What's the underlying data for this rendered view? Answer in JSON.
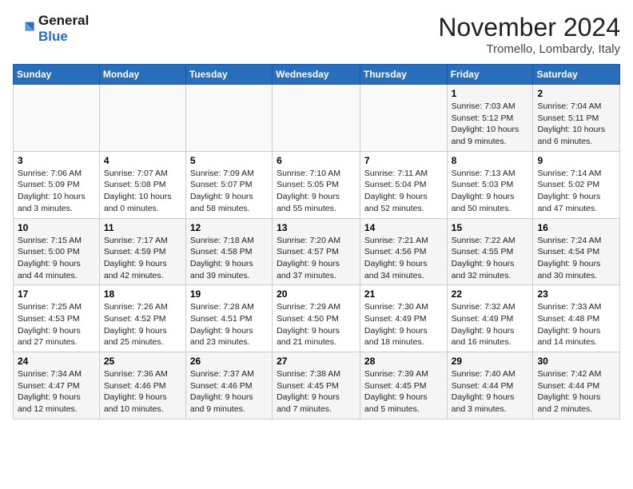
{
  "logo": {
    "text_general": "General",
    "text_blue": "Blue"
  },
  "title": "November 2024",
  "location": "Tromello, Lombardy, Italy",
  "weekdays": [
    "Sunday",
    "Monday",
    "Tuesday",
    "Wednesday",
    "Thursday",
    "Friday",
    "Saturday"
  ],
  "weeks": [
    [
      {
        "day": "",
        "info": ""
      },
      {
        "day": "",
        "info": ""
      },
      {
        "day": "",
        "info": ""
      },
      {
        "day": "",
        "info": ""
      },
      {
        "day": "",
        "info": ""
      },
      {
        "day": "1",
        "info": "Sunrise: 7:03 AM\nSunset: 5:12 PM\nDaylight: 10 hours and 9 minutes."
      },
      {
        "day": "2",
        "info": "Sunrise: 7:04 AM\nSunset: 5:11 PM\nDaylight: 10 hours and 6 minutes."
      }
    ],
    [
      {
        "day": "3",
        "info": "Sunrise: 7:06 AM\nSunset: 5:09 PM\nDaylight: 10 hours and 3 minutes."
      },
      {
        "day": "4",
        "info": "Sunrise: 7:07 AM\nSunset: 5:08 PM\nDaylight: 10 hours and 0 minutes."
      },
      {
        "day": "5",
        "info": "Sunrise: 7:09 AM\nSunset: 5:07 PM\nDaylight: 9 hours and 58 minutes."
      },
      {
        "day": "6",
        "info": "Sunrise: 7:10 AM\nSunset: 5:05 PM\nDaylight: 9 hours and 55 minutes."
      },
      {
        "day": "7",
        "info": "Sunrise: 7:11 AM\nSunset: 5:04 PM\nDaylight: 9 hours and 52 minutes."
      },
      {
        "day": "8",
        "info": "Sunrise: 7:13 AM\nSunset: 5:03 PM\nDaylight: 9 hours and 50 minutes."
      },
      {
        "day": "9",
        "info": "Sunrise: 7:14 AM\nSunset: 5:02 PM\nDaylight: 9 hours and 47 minutes."
      }
    ],
    [
      {
        "day": "10",
        "info": "Sunrise: 7:15 AM\nSunset: 5:00 PM\nDaylight: 9 hours and 44 minutes."
      },
      {
        "day": "11",
        "info": "Sunrise: 7:17 AM\nSunset: 4:59 PM\nDaylight: 9 hours and 42 minutes."
      },
      {
        "day": "12",
        "info": "Sunrise: 7:18 AM\nSunset: 4:58 PM\nDaylight: 9 hours and 39 minutes."
      },
      {
        "day": "13",
        "info": "Sunrise: 7:20 AM\nSunset: 4:57 PM\nDaylight: 9 hours and 37 minutes."
      },
      {
        "day": "14",
        "info": "Sunrise: 7:21 AM\nSunset: 4:56 PM\nDaylight: 9 hours and 34 minutes."
      },
      {
        "day": "15",
        "info": "Sunrise: 7:22 AM\nSunset: 4:55 PM\nDaylight: 9 hours and 32 minutes."
      },
      {
        "day": "16",
        "info": "Sunrise: 7:24 AM\nSunset: 4:54 PM\nDaylight: 9 hours and 30 minutes."
      }
    ],
    [
      {
        "day": "17",
        "info": "Sunrise: 7:25 AM\nSunset: 4:53 PM\nDaylight: 9 hours and 27 minutes."
      },
      {
        "day": "18",
        "info": "Sunrise: 7:26 AM\nSunset: 4:52 PM\nDaylight: 9 hours and 25 minutes."
      },
      {
        "day": "19",
        "info": "Sunrise: 7:28 AM\nSunset: 4:51 PM\nDaylight: 9 hours and 23 minutes."
      },
      {
        "day": "20",
        "info": "Sunrise: 7:29 AM\nSunset: 4:50 PM\nDaylight: 9 hours and 21 minutes."
      },
      {
        "day": "21",
        "info": "Sunrise: 7:30 AM\nSunset: 4:49 PM\nDaylight: 9 hours and 18 minutes."
      },
      {
        "day": "22",
        "info": "Sunrise: 7:32 AM\nSunset: 4:49 PM\nDaylight: 9 hours and 16 minutes."
      },
      {
        "day": "23",
        "info": "Sunrise: 7:33 AM\nSunset: 4:48 PM\nDaylight: 9 hours and 14 minutes."
      }
    ],
    [
      {
        "day": "24",
        "info": "Sunrise: 7:34 AM\nSunset: 4:47 PM\nDaylight: 9 hours and 12 minutes."
      },
      {
        "day": "25",
        "info": "Sunrise: 7:36 AM\nSunset: 4:46 PM\nDaylight: 9 hours and 10 minutes."
      },
      {
        "day": "26",
        "info": "Sunrise: 7:37 AM\nSunset: 4:46 PM\nDaylight: 9 hours and 9 minutes."
      },
      {
        "day": "27",
        "info": "Sunrise: 7:38 AM\nSunset: 4:45 PM\nDaylight: 9 hours and 7 minutes."
      },
      {
        "day": "28",
        "info": "Sunrise: 7:39 AM\nSunset: 4:45 PM\nDaylight: 9 hours and 5 minutes."
      },
      {
        "day": "29",
        "info": "Sunrise: 7:40 AM\nSunset: 4:44 PM\nDaylight: 9 hours and 3 minutes."
      },
      {
        "day": "30",
        "info": "Sunrise: 7:42 AM\nSunset: 4:44 PM\nDaylight: 9 hours and 2 minutes."
      }
    ]
  ]
}
